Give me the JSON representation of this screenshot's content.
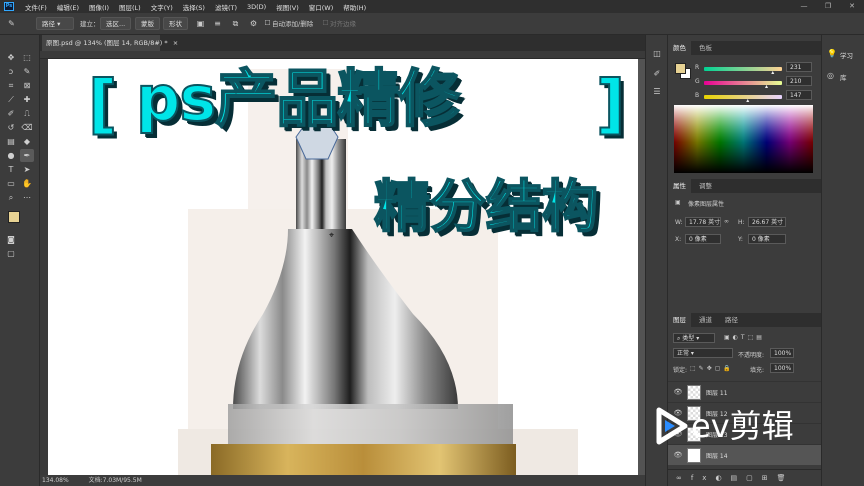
{
  "app": {
    "logo": "Ps"
  },
  "menu": [
    "文件(F)",
    "编辑(E)",
    "图像(I)",
    "图层(L)",
    "文字(Y)",
    "选择(S)",
    "滤镜(T)",
    "3D(D)",
    "视图(V)",
    "窗口(W)",
    "帮助(H)"
  ],
  "window_controls": {
    "minimize": "—",
    "restore": "❐",
    "close": "✕"
  },
  "options": {
    "mode_select": "路径",
    "build_label": "建立：",
    "selection_btn": "选区...",
    "mask_btn": "蒙版",
    "shape_btn": "形状",
    "auto_add_label": "自动添加/删除",
    "align_edges_label": "对齐边缘"
  },
  "document": {
    "tab_title": "原图.psd @ 134% (图层 14, RGB/8#) *",
    "tab_close": "×",
    "zoom": "134.08%",
    "doc_info": "文档:7.03M/95.5M"
  },
  "canvas_overlay": {
    "bracket_left": "[",
    "title": "ps产品精修",
    "bracket_right": "]",
    "subtitle": "精分结构",
    "watermark": "ev剪辑"
  },
  "color_panel": {
    "tabs": [
      "颜色",
      "色板"
    ],
    "channels": [
      {
        "label": "R",
        "value": "231"
      },
      {
        "label": "G",
        "value": "210"
      },
      {
        "label": "B",
        "value": "147"
      }
    ],
    "slider_positions": [
      0.9,
      0.82,
      0.58
    ],
    "foreground": "#e7d293",
    "background": "#ffffff"
  },
  "properties_panel": {
    "tabs": [
      "属性",
      "调整"
    ],
    "kind": "像素图层属性",
    "w_label": "W:",
    "w_value": "17.78 英寸",
    "link_icon": "∞",
    "h_label": "H:",
    "h_value": "26.67 英寸",
    "x_label": "X:",
    "x_value": "0 像素",
    "y_label": "Y:",
    "y_value": "0 像素"
  },
  "layers_panel": {
    "tabs": [
      "图层",
      "通道",
      "路径"
    ],
    "filter": "类型",
    "blend_mode": "正常",
    "opacity_label": "不透明度:",
    "opacity_value": "100%",
    "lock_label": "锁定:",
    "fill_label": "填充:",
    "fill_value": "100%",
    "layers": [
      {
        "name": "图层 11"
      },
      {
        "name": "图层 12"
      },
      {
        "name": "图层 13"
      },
      {
        "name": "图层 14"
      }
    ]
  },
  "learn_panel": {
    "items": [
      {
        "label": "学习"
      },
      {
        "label": "库"
      }
    ]
  }
}
